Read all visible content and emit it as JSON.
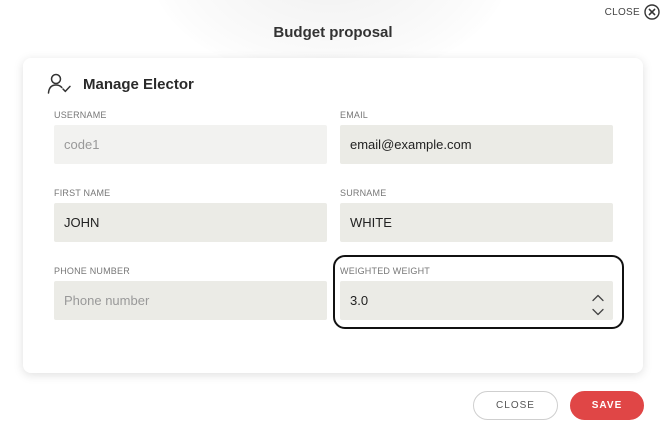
{
  "header": {
    "close_label": "CLOSE",
    "title": "Budget proposal"
  },
  "card": {
    "title": "Manage Elector",
    "fields": {
      "username": {
        "label": "USERNAME",
        "value": "code1"
      },
      "email": {
        "label": "EMAIL",
        "value": "email@example.com"
      },
      "first_name": {
        "label": "FIRST NAME",
        "value": "JOHN"
      },
      "surname": {
        "label": "SURNAME",
        "value": "WHITE"
      },
      "phone": {
        "label": "PHONE NUMBER",
        "value": "",
        "placeholder": "Phone number"
      },
      "weight": {
        "label": "WEIGHTED WEIGHT",
        "value": "3.0"
      }
    }
  },
  "footer": {
    "close_label": "CLOSE",
    "save_label": "SAVE"
  },
  "colors": {
    "accent": "#e04646",
    "input_background": "#ebebe6",
    "highlight_border": "#111111"
  },
  "icons": {
    "close_top": "close-circle-icon",
    "card_header": "user-check-icon",
    "stepper_up": "chevron-up-icon",
    "stepper_down": "chevron-down-icon"
  }
}
